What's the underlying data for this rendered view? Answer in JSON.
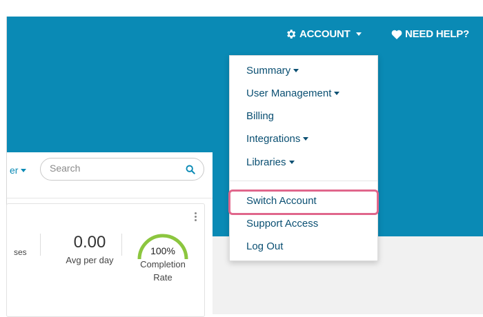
{
  "header": {
    "account_label": "ACCOUNT",
    "help_label": "NEED HELP?"
  },
  "account_menu": {
    "items": [
      {
        "label": "Summary",
        "has_submenu": true
      },
      {
        "label": "User Management",
        "has_submenu": true
      },
      {
        "label": "Billing",
        "has_submenu": false
      },
      {
        "label": "Integrations",
        "has_submenu": true
      },
      {
        "label": "Libraries",
        "has_submenu": true
      },
      {
        "label": "Switch Account",
        "has_submenu": false,
        "highlighted": true
      },
      {
        "label": "Support Access",
        "has_submenu": false
      },
      {
        "label": "Log Out",
        "has_submenu": false
      }
    ]
  },
  "toolbar": {
    "filter_fragment": "er",
    "search_placeholder": "Search"
  },
  "stats": {
    "responses_fragment": "ses",
    "avg_value": "0.00",
    "avg_label": "Avg per day",
    "completion_value": "100%",
    "completion_label": "Completion Rate",
    "completion_fraction": 1.0
  },
  "colors": {
    "brand_blue": "#0a8ab5",
    "menu_text": "#0a4f72",
    "highlight": "#e0668b",
    "gauge_green": "#8cc63f"
  }
}
